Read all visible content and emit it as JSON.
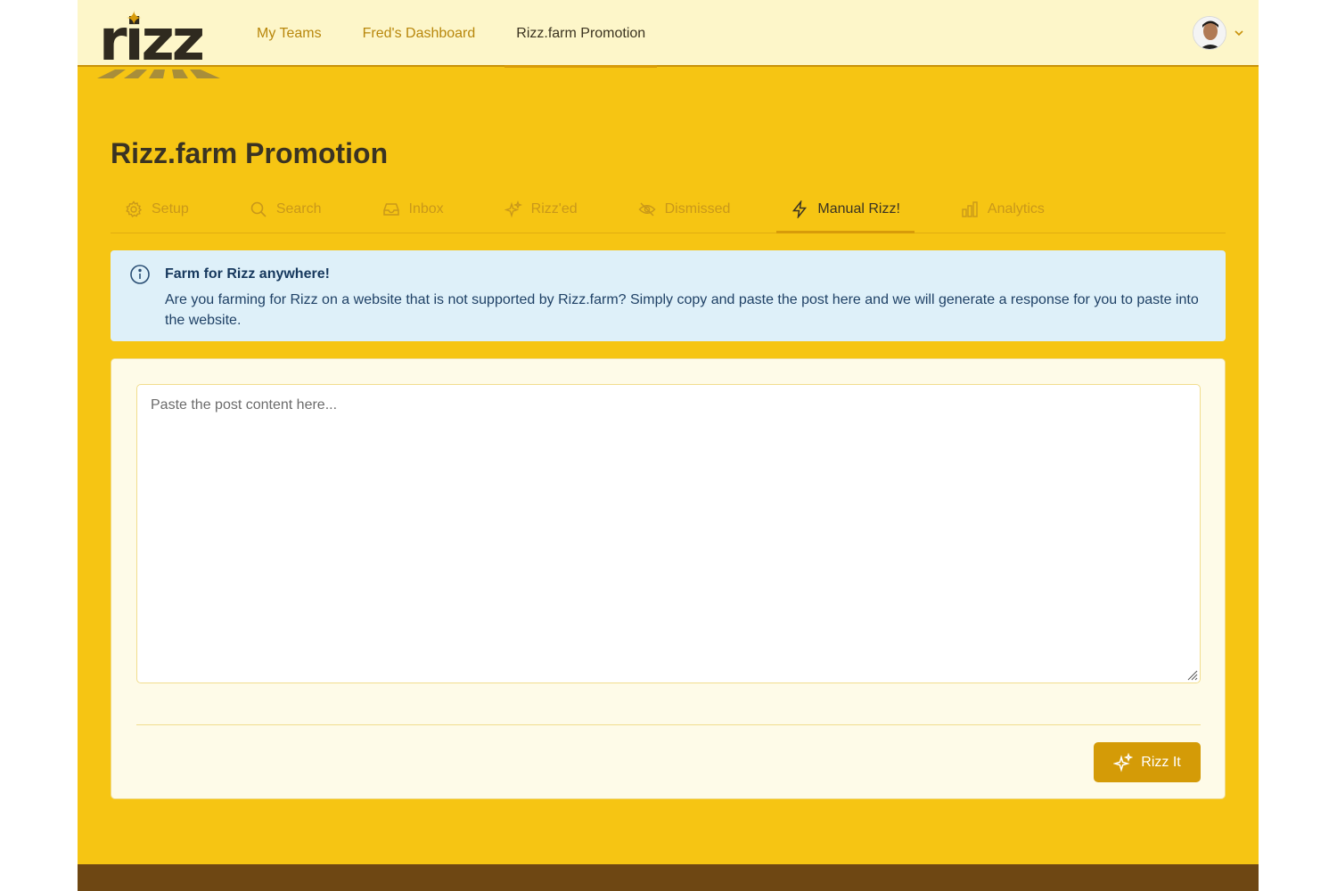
{
  "app": {
    "logo_text": "rizz"
  },
  "nav": {
    "items": [
      {
        "label": "My Teams"
      },
      {
        "label": "Fred's Dashboard"
      },
      {
        "label": "Rizz.farm Promotion"
      }
    ]
  },
  "page": {
    "title": "Rizz.farm Promotion"
  },
  "tabs": [
    {
      "label": "Setup",
      "icon": "gear-icon"
    },
    {
      "label": "Search",
      "icon": "search-icon"
    },
    {
      "label": "Inbox",
      "icon": "inbox-icon"
    },
    {
      "label": "Rizz'ed",
      "icon": "sparkles-icon"
    },
    {
      "label": "Dismissed",
      "icon": "eye-off-icon"
    },
    {
      "label": "Manual Rizz!",
      "icon": "lightning-icon"
    },
    {
      "label": "Analytics",
      "icon": "bar-chart-icon"
    }
  ],
  "alert": {
    "title": "Farm for Rizz anywhere!",
    "body": "Are you farming for Rizz on a website that is not supported by Rizz.farm? Simply copy and paste the post here and we will generate a response for you to paste into the website."
  },
  "post_input": {
    "placeholder": "Paste the post content here...",
    "value": ""
  },
  "action": {
    "label": "Rizz It"
  },
  "colors": {
    "accent": "#d49b07",
    "background": "#f6c513",
    "topbar": "#fdf6c9",
    "info_bg": "#def0f9",
    "footer": "#6e4713"
  }
}
